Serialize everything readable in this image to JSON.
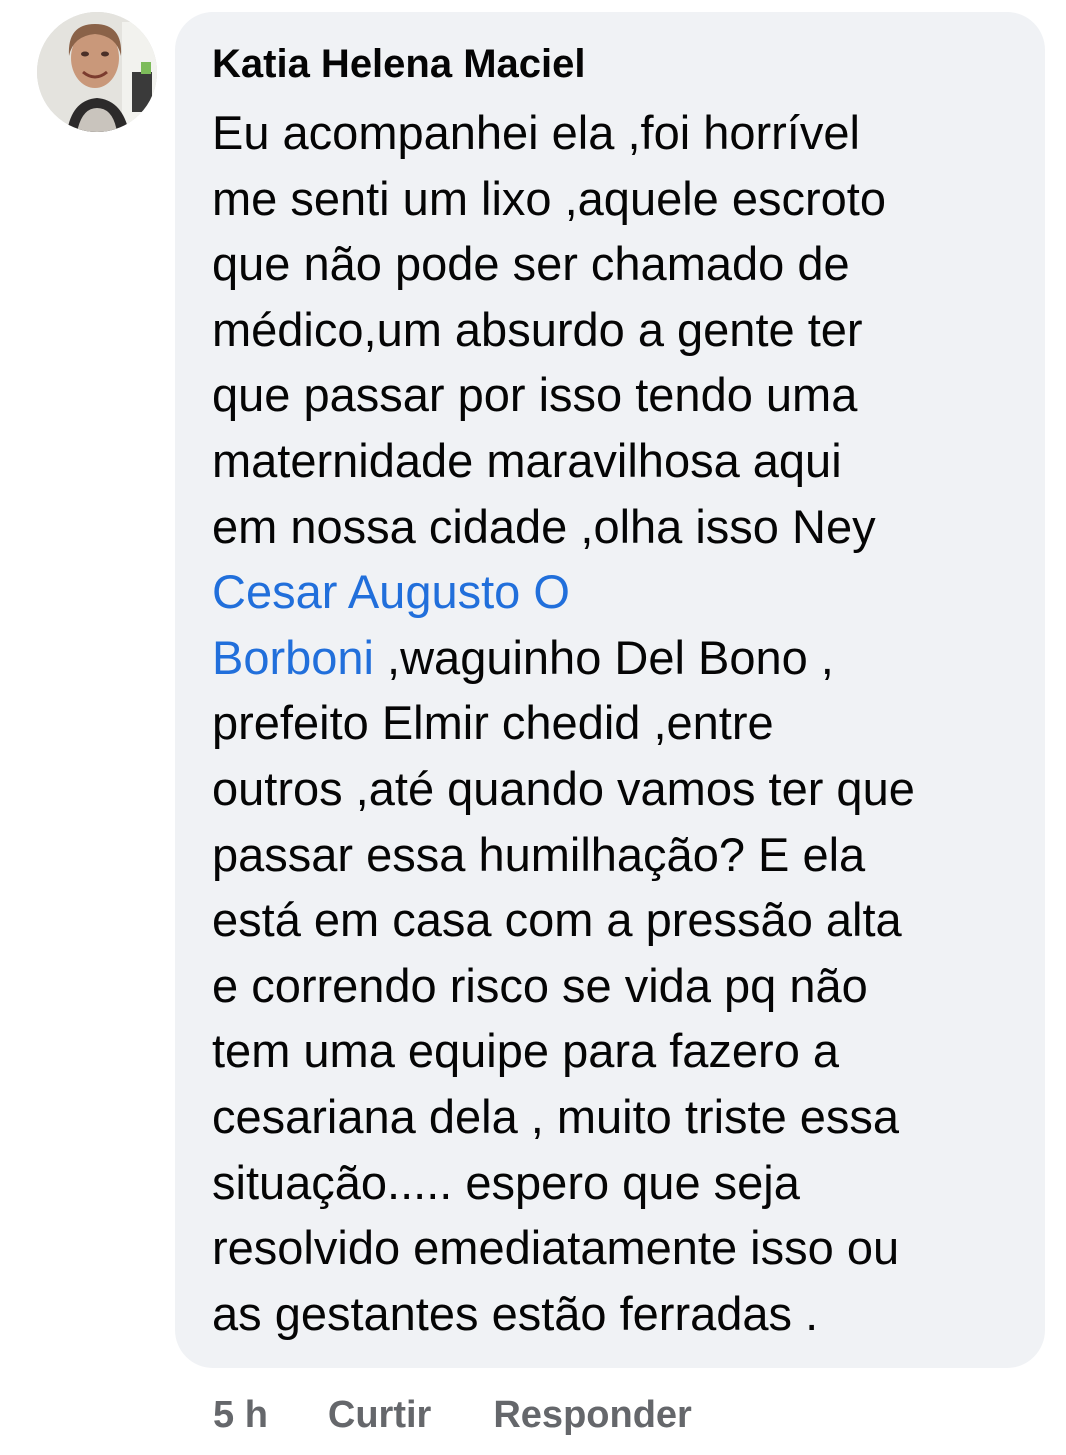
{
  "comment": {
    "author": "Katia Helena Maciel",
    "text_part1": "Eu acompanhei ela ,foi horrível\nme senti um lixo ,aquele escroto\nque não pode ser chamado de\nmédico,um absurdo a gente ter\nque passar por isso tendo uma\nmaternidade maravilhosa aqui\nem nossa cidade ,olha isso  Ney\n",
    "mention": "Cesar Augusto O\nBorboni",
    "text_part2": " ,waguinho Del Bono ,\nprefeito Elmir chedid ,entre\noutros ,até quando vamos ter que\npassar essa humilhação? E ela\nestá em casa com a pressão alta\ne correndo risco se vida pq não\ntem uma equipe para fazero a\ncesariana dela , muito triste essa\nsituação..... espero que seja\nresolvido emediatamente isso ou\nas gestantes estão  ferradas ."
  },
  "actions": {
    "time": "5 h",
    "like_label": "Curtir",
    "reply_label": "Responder"
  },
  "colors": {
    "bubble_bg": "#f0f2f5",
    "mention": "#216fdb",
    "meta_text": "#65676b"
  },
  "icons": {
    "avatar": "profile-photo-avatar"
  }
}
